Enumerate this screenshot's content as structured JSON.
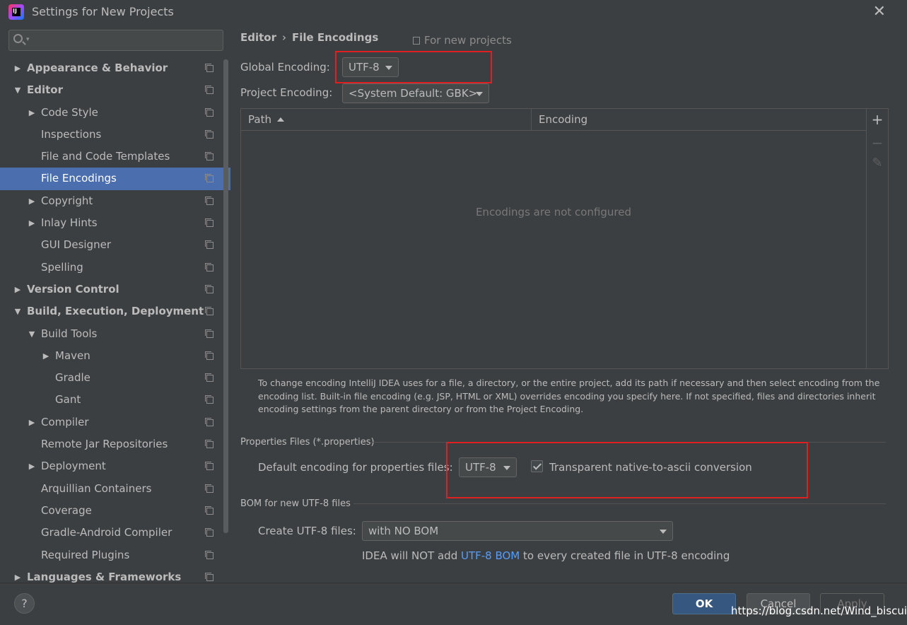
{
  "window": {
    "title": "Settings for New Projects",
    "app_icon": "intellij-idea-icon",
    "app_icon_text": "IJ"
  },
  "search": {
    "placeholder": "",
    "value": ""
  },
  "tree": [
    {
      "label": "Appearance & Behavior",
      "level": 0,
      "bold": true,
      "expander": "collapsed"
    },
    {
      "label": "Editor",
      "level": 0,
      "bold": true,
      "expander": "expanded"
    },
    {
      "label": "Code Style",
      "level": 1,
      "expander": "collapsed"
    },
    {
      "label": "Inspections",
      "level": 1,
      "expander": "none"
    },
    {
      "label": "File and Code Templates",
      "level": 1,
      "expander": "none"
    },
    {
      "label": "File Encodings",
      "level": 1,
      "expander": "none",
      "selected": true
    },
    {
      "label": "Copyright",
      "level": 1,
      "expander": "collapsed"
    },
    {
      "label": "Inlay Hints",
      "level": 1,
      "expander": "collapsed"
    },
    {
      "label": "GUI Designer",
      "level": 1,
      "expander": "none"
    },
    {
      "label": "Spelling",
      "level": 1,
      "expander": "none"
    },
    {
      "label": "Version Control",
      "level": 0,
      "bold": true,
      "expander": "collapsed"
    },
    {
      "label": "Build, Execution, Deployment",
      "level": 0,
      "bold": true,
      "expander": "expanded"
    },
    {
      "label": "Build Tools",
      "level": 1,
      "expander": "expanded"
    },
    {
      "label": "Maven",
      "level": 2,
      "expander": "collapsed"
    },
    {
      "label": "Gradle",
      "level": 2,
      "expander": "none"
    },
    {
      "label": "Gant",
      "level": 2,
      "expander": "none"
    },
    {
      "label": "Compiler",
      "level": 1,
      "expander": "collapsed"
    },
    {
      "label": "Remote Jar Repositories",
      "level": 1,
      "expander": "none"
    },
    {
      "label": "Deployment",
      "level": 1,
      "expander": "collapsed"
    },
    {
      "label": "Arquillian Containers",
      "level": 1,
      "expander": "none"
    },
    {
      "label": "Coverage",
      "level": 1,
      "expander": "none"
    },
    {
      "label": "Gradle-Android Compiler",
      "level": 1,
      "expander": "none"
    },
    {
      "label": "Required Plugins",
      "level": 1,
      "expander": "none"
    },
    {
      "label": "Languages & Frameworks",
      "level": 0,
      "bold": true,
      "expander": "collapsed"
    }
  ],
  "breadcrumb": {
    "parent": "Editor",
    "separator": "›",
    "current": "File Encodings"
  },
  "scope_note": "For new projects",
  "global_encoding": {
    "label": "Global Encoding:",
    "value": "UTF-8"
  },
  "project_encoding": {
    "label": "Project Encoding:",
    "value": "<System Default: GBK>"
  },
  "table": {
    "columns": [
      "Path",
      "Encoding"
    ],
    "sorted_column": "Path",
    "rows": [],
    "empty_text": "Encodings are not configured",
    "toolbar": {
      "add": "+",
      "remove": "−",
      "edit": "✎"
    }
  },
  "help_text": "To change encoding IntelliJ IDEA uses for a file, a directory, or the entire project, add its path if necessary and then select encoding from the encoding list. Built-in file encoding (e.g. JSP, HTML or XML) overrides encoding you specify here. If not specified, files and directories inherit encoding settings from the parent directory or from the Project Encoding.",
  "properties": {
    "group_title": "Properties Files (*.properties)",
    "default_label": "Default encoding for properties files:",
    "default_value": "UTF-8",
    "native_to_ascii_label": "Transparent native-to-ascii conversion",
    "native_to_ascii_checked": true
  },
  "bom": {
    "group_title": "BOM for new UTF-8 files",
    "create_label": "Create UTF-8 files:",
    "create_value": "with NO BOM",
    "note_prefix": "IDEA will NOT add ",
    "note_link": "UTF-8 BOM",
    "note_suffix": " to every created file in UTF-8 encoding"
  },
  "footer": {
    "help": "?",
    "ok": "OK",
    "cancel": "Cancel",
    "apply": "Apply"
  },
  "watermark": "https://blog.csdn.net/Wind_biscuit",
  "colors": {
    "background": "#3c3f41",
    "selection": "#4b6eaf",
    "highlight_box": "#e02020",
    "link": "#589df6",
    "ok_button": "#365880"
  }
}
